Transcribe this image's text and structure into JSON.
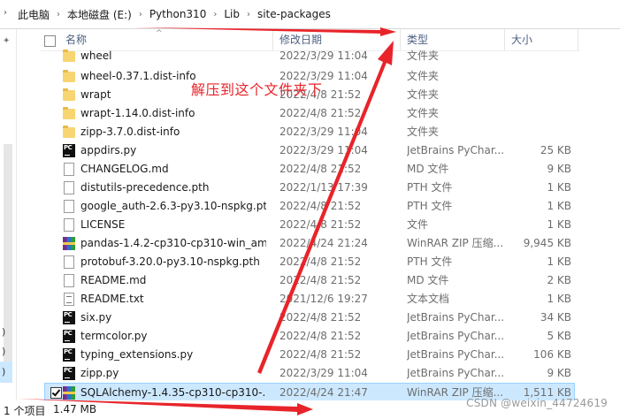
{
  "address_bar": {
    "crumbs": [
      "此电脑",
      "本地磁盘 (E:)",
      "Python310",
      "Lib",
      "site-packages"
    ]
  },
  "columns": {
    "name": "名称",
    "date": "修改日期",
    "type": "类型",
    "size": "大小"
  },
  "files": [
    {
      "name": "wheel",
      "date": "2022/3/29 11:04",
      "type": "文件夹",
      "size": "",
      "icon": "folder-icon"
    },
    {
      "name": "wheel-0.37.1.dist-info",
      "date": "2022/3/29 11:04",
      "type": "文件夹",
      "size": "",
      "icon": "folder-icon"
    },
    {
      "name": "wrapt",
      "date": "2022/4/8 21:52",
      "type": "文件夹",
      "size": "",
      "icon": "folder-icon"
    },
    {
      "name": "wrapt-1.14.0.dist-info",
      "date": "2022/4/8 21:52",
      "type": "文件夹",
      "size": "",
      "icon": "folder-icon"
    },
    {
      "name": "zipp-3.7.0.dist-info",
      "date": "2022/3/29 11:04",
      "type": "文件夹",
      "size": "",
      "icon": "folder-icon"
    },
    {
      "name": "appdirs.py",
      "date": "2022/3/29 11:04",
      "type": "JetBrains PyChar...",
      "size": "25 KB",
      "icon": "pycharm-file-icon"
    },
    {
      "name": "CHANGELOG.md",
      "date": "2022/4/8 21:52",
      "type": "MD 文件",
      "size": "9 KB",
      "icon": "file-icon"
    },
    {
      "name": "distutils-precedence.pth",
      "date": "2022/1/13 17:39",
      "type": "PTH 文件",
      "size": "1 KB",
      "icon": "file-icon"
    },
    {
      "name": "google_auth-2.6.3-py3.10-nspkg.pth",
      "date": "2022/4/8 21:52",
      "type": "PTH 文件",
      "size": "1 KB",
      "icon": "file-icon"
    },
    {
      "name": "LICENSE",
      "date": "2022/4/8 21:52",
      "type": "文件",
      "size": "1 KB",
      "icon": "file-icon"
    },
    {
      "name": "pandas-1.4.2-cp310-cp310-win_am...",
      "date": "2022/4/24 21:24",
      "type": "WinRAR ZIP 压缩...",
      "size": "9,945 KB",
      "icon": "winrar-icon"
    },
    {
      "name": "protobuf-3.20.0-py3.10-nspkg.pth",
      "date": "2022/4/8 21:52",
      "type": "PTH 文件",
      "size": "1 KB",
      "icon": "file-icon"
    },
    {
      "name": "README.md",
      "date": "2022/4/8 21:52",
      "type": "MD 文件",
      "size": "2 KB",
      "icon": "file-icon"
    },
    {
      "name": "README.txt",
      "date": "2021/12/6 19:27",
      "type": "文本文档",
      "size": "1 KB",
      "icon": "text-file-icon"
    },
    {
      "name": "six.py",
      "date": "2022/4/8 21:52",
      "type": "JetBrains PyChar...",
      "size": "34 KB",
      "icon": "pycharm-file-icon"
    },
    {
      "name": "termcolor.py",
      "date": "2022/4/8 21:52",
      "type": "JetBrains PyChar...",
      "size": "5 KB",
      "icon": "pycharm-file-icon"
    },
    {
      "name": "typing_extensions.py",
      "date": "2022/4/8 21:52",
      "type": "JetBrains PyChar...",
      "size": "106 KB",
      "icon": "pycharm-file-icon"
    },
    {
      "name": "zipp.py",
      "date": "2022/3/29 11:04",
      "type": "JetBrains PyChar...",
      "size": "9 KB",
      "icon": "pycharm-file-icon"
    },
    {
      "name": "SQLAlchemy-1.4.35-cp310-cp310-...",
      "date": "2022/4/24 21:47",
      "type": "WinRAR ZIP 压缩...",
      "size": "1,511 KB",
      "icon": "winrar-icon",
      "selected": true
    }
  ],
  "status_bar": {
    "item_count": "1 个项目",
    "selected_size": "1.47 MB"
  },
  "annotation": {
    "text": "解压到这个文件夹下",
    "color": "#e8242a"
  },
  "watermark": "CSDN @weixin_44724619",
  "colors": {
    "selection": "#cce8ff",
    "header_text": "#4d6082",
    "annotation": "#e8242a"
  }
}
